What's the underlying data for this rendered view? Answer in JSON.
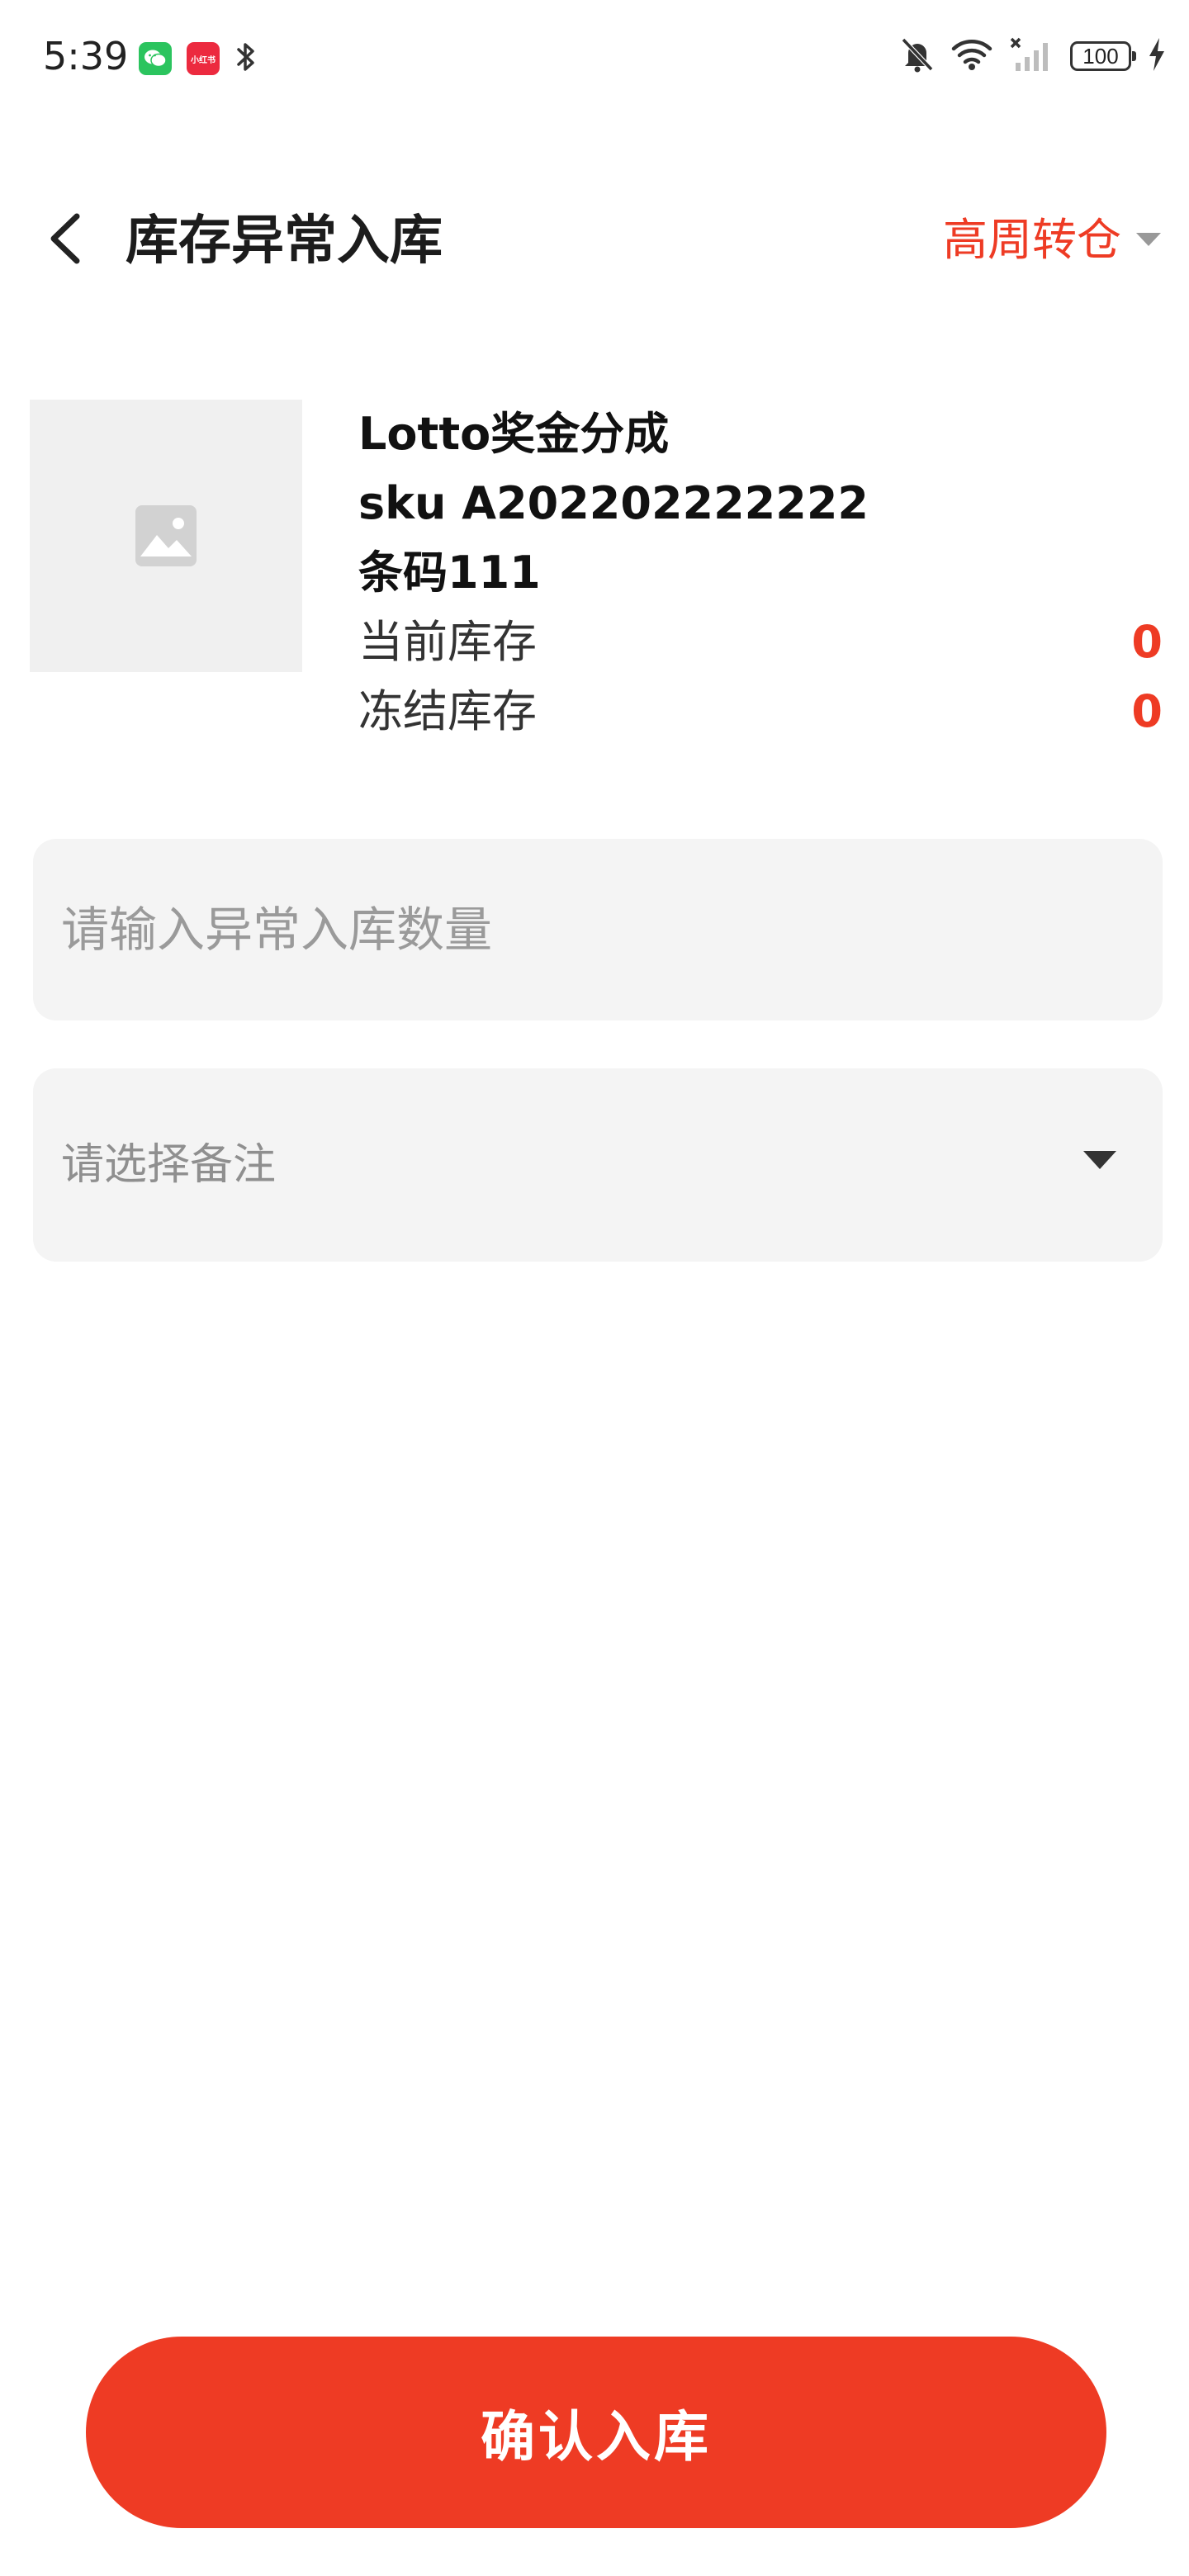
{
  "status_bar": {
    "time": "5:39",
    "app_icon_xhs_text": "小红书",
    "battery": "100"
  },
  "header": {
    "title": "库存异常入库",
    "warehouse": "高周转仓"
  },
  "product": {
    "name": "Lotto奖金分成",
    "sku": "sku A202202222222",
    "barcode": "条码111",
    "current_stock_label": "当前库存",
    "current_stock_value": "0",
    "frozen_stock_label": "冻结库存",
    "frozen_stock_value": "0"
  },
  "form": {
    "quantity_placeholder": "请输入异常入库数量",
    "remark_placeholder": "请选择备注"
  },
  "footer": {
    "confirm_label": "确认入库"
  },
  "colors": {
    "accent": "#ee3b24",
    "field_bg": "#f4f4f4",
    "placeholder": "#9a9a9a"
  },
  "icons": [
    "wechat-icon",
    "xiaohongshu-icon",
    "bluetooth-icon",
    "mute-bell-icon",
    "wifi-icon",
    "signal-icon",
    "battery-icon",
    "charging-icon",
    "back-arrow-icon",
    "caret-down-icon",
    "image-placeholder-icon"
  ]
}
